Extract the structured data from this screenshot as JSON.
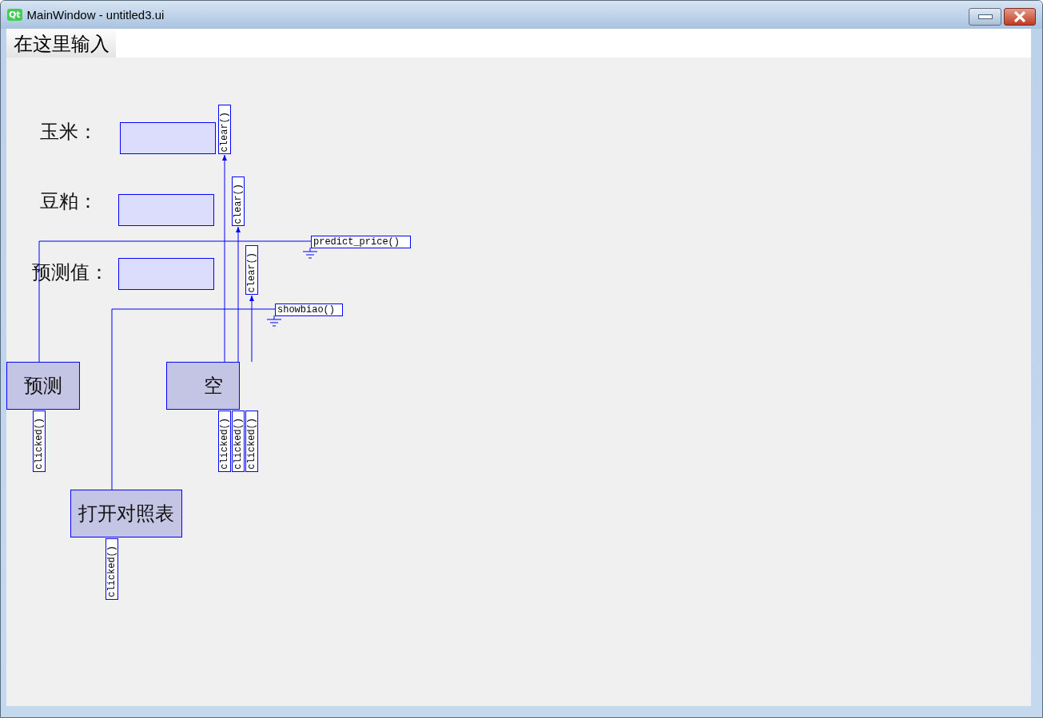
{
  "window": {
    "title": "MainWindow - untitled3.ui",
    "app_icon_text": "Qt"
  },
  "menu_bar": {
    "placeholder": "在这里输入"
  },
  "form": {
    "labels": [
      {
        "text": "玉米："
      },
      {
        "text": "豆粕："
      },
      {
        "text": "预测值："
      }
    ],
    "line_edits": [
      {
        "kind": "line_edit"
      },
      {
        "kind": "line_edit"
      },
      {
        "kind": "line_edit"
      }
    ],
    "buttons": [
      {
        "text": "预测"
      },
      {
        "text": "空"
      },
      {
        "text": "打开对照表"
      }
    ],
    "connections": [
      {
        "signal": "clicked()",
        "slot": "predict_price()",
        "kind": "form"
      },
      {
        "signal": "clicked()",
        "slot": "clear()",
        "kind": "widget"
      },
      {
        "signal": "clicked()",
        "slot": "clear()",
        "kind": "widget"
      },
      {
        "signal": "clicked()",
        "slot": "clear()",
        "kind": "widget"
      },
      {
        "signal": "clicked()",
        "slot": "showbiao()",
        "kind": "form"
      }
    ]
  }
}
